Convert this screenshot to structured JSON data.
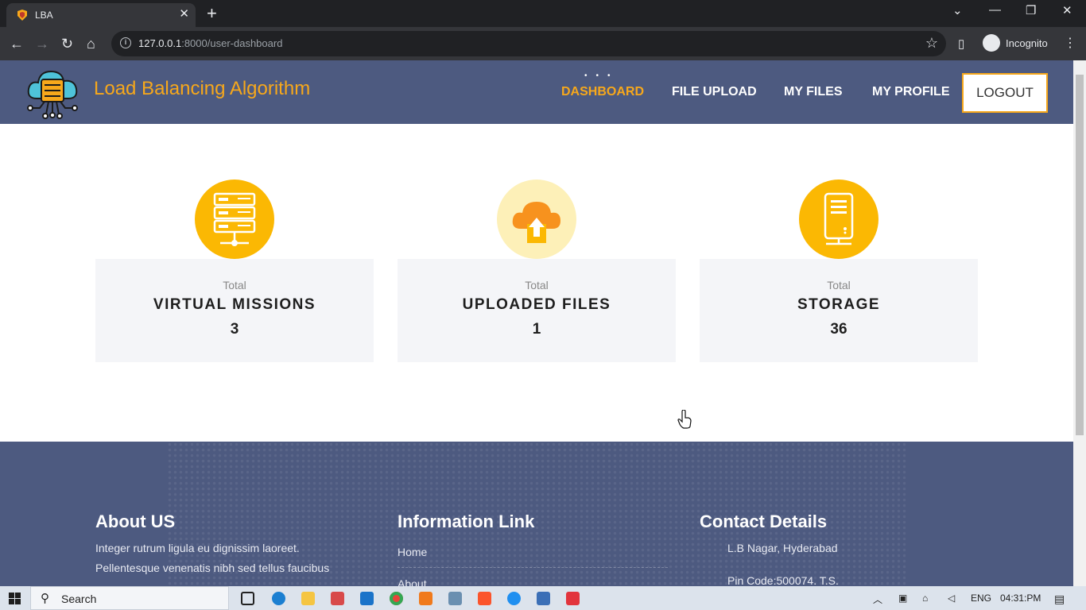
{
  "browser": {
    "tab_title": "LBA",
    "url_host": "127.0.0.1",
    "url_rest": ":8000/user-dashboard",
    "incognito_label": "Incognito"
  },
  "site": {
    "brand": "Load Balancing Algorithm",
    "nav": {
      "dashboard": "DASHBOARD",
      "file_upload": "FILE UPLOAD",
      "my_files": "MY FILES",
      "my_profile": "MY PROFILE",
      "logout": "LOGOUT"
    },
    "accent_color": "#f7a81b",
    "header_color": "#4d5a80"
  },
  "cards": [
    {
      "label": "Total",
      "title": "VIRTUAL MISSIONS",
      "value": "3",
      "icon": "server-rack-icon"
    },
    {
      "label": "Total",
      "title": "UPLOADED FILES",
      "value": "1",
      "icon": "cloud-upload-icon"
    },
    {
      "label": "Total",
      "title": "STORAGE",
      "value": "36",
      "icon": "storage-server-icon"
    }
  ],
  "footer": {
    "about_title": "About US",
    "about_line1": "Integer rutrum ligula eu dignissim laoreet.",
    "about_line2": "Pellentesque venenatis nibh sed tellus faucibus",
    "info_title": "Information Link",
    "link_home": "Home",
    "link_about": "About",
    "contact_title": "Contact Details",
    "address": "L.B Nagar, Hyderabad",
    "pincode": "Pin Code:500074. T.S."
  },
  "taskbar": {
    "search": "Search",
    "lang": "ENG",
    "time": "04:31:PM"
  }
}
